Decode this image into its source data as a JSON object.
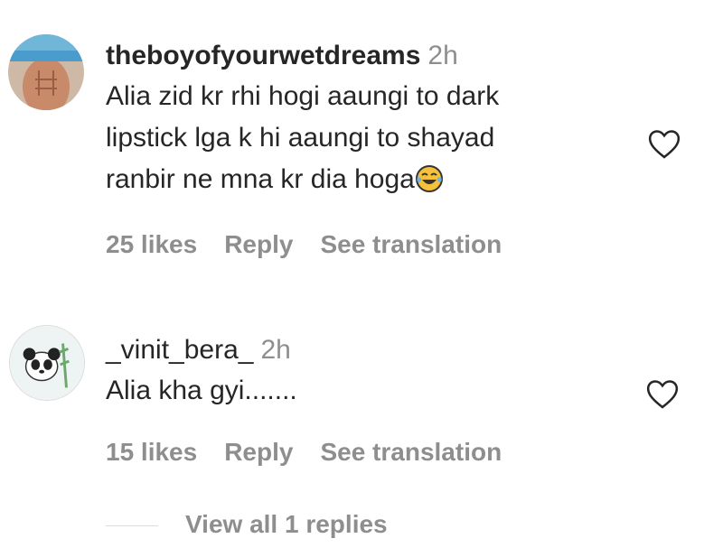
{
  "comments": [
    {
      "username": "theboyofyourwetdreams",
      "time": "2h",
      "lines": [
        "Alia zid kr rhi hogi aaungi to dark",
        "lipstick lga k hi aaungi to shayad",
        "ranbir ne mna kr dia hoga"
      ],
      "emoji": "face-with-tears-of-joy-icon",
      "likes": "25 likes",
      "reply": "Reply",
      "translate": "See translation"
    },
    {
      "username": "_vinit_bera_",
      "time": "2h",
      "lines": [
        "Alia kha gyi......."
      ],
      "likes": "15 likes",
      "reply": "Reply",
      "translate": "See translation"
    }
  ],
  "view_replies": "View all 1 replies",
  "colors": {
    "text": "#262626",
    "secondary": "#8e8e8e",
    "divider": "#dbdbdb"
  }
}
